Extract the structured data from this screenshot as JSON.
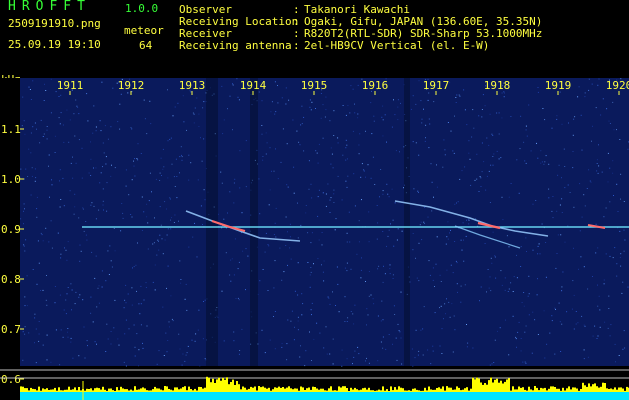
{
  "header": {
    "app_title": "HROFFT",
    "app_version": "1.0.0",
    "file_name": "2509191910.png",
    "timestamp": "25.09.19 19:10",
    "mode_label": "meteor",
    "mode_count": "64"
  },
  "info": [
    {
      "label": "Observer",
      "value": "Takanori Kawachi"
    },
    {
      "label": "Receiving Location",
      "value": "Ogaki, Gifu, JAPAN (136.60E, 35.35N)"
    },
    {
      "label": "Receiver",
      "value": "R820T2(RTL-SDR) SDR-Sharp 53.1000MHz"
    },
    {
      "label": "Receiving antenna",
      "value": "2el-HB9CV Vertical (el. E-W)"
    }
  ],
  "plot": {
    "freq_unit": "kHz",
    "time_ticks": [
      "1911",
      "1912",
      "1913",
      "1914",
      "1915",
      "1916",
      "1917",
      "1918",
      "1919",
      "1920"
    ],
    "freq_ticks": [
      "1.1",
      "1.0",
      "0.9",
      "0.8",
      "0.7",
      "0.6"
    ],
    "colors": {
      "background": "#0a1a5c",
      "noise": "#2a55c8",
      "carrier": "#6fe8ff",
      "meteor": "#ff6a6a",
      "level_bar": "#ffff00",
      "level_base": "#00e5ff"
    }
  }
}
